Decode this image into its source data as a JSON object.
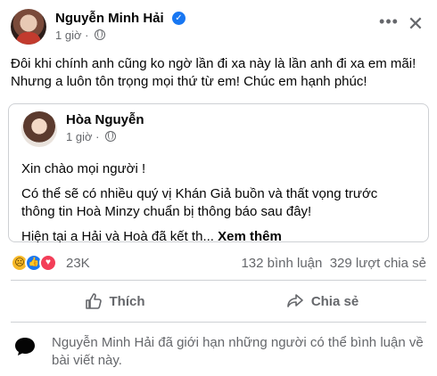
{
  "post": {
    "author": "Nguyễn Minh Hải",
    "time": "1 giờ ·",
    "body_lines": [
      "Đôi khi chính anh cũng ko ngờ lần đi xa này là lần anh đi xa em mãi!",
      "Nhưng a luôn tôn trọng mọi thứ từ em! Chúc em hạnh phúc!"
    ],
    "more_icon": "more-horizontal-icon",
    "close_icon": "close-icon"
  },
  "shared": {
    "author": "Hòa Nguyễn",
    "time": "1 giờ ·",
    "lines": [
      "Xin chào mọi người !",
      "Có thể sẽ có nhiều quý vị Khán Giả buồn và thất vọng trước thông tin Hoà Minzy chuẩn bị thông báo sau đây!"
    ],
    "teaser": "Hiện tại a Hải và Hoà đã kết th... ",
    "see_more": "Xem thêm"
  },
  "reactions": {
    "count": "23K",
    "comments": "132 bình luận",
    "shares": "329 lượt chia sẻ",
    "types": [
      "sad",
      "like",
      "love"
    ]
  },
  "actions": {
    "like_label": "Thích",
    "share_label": "Chia sẻ"
  },
  "notice": {
    "text": "Nguyễn Minh Hải đã giới hạn những người có thể bình luận về bài viết này."
  },
  "colors": {
    "primary_text": "#050505",
    "secondary_text": "#65676b",
    "verified_blue": "#1877f2",
    "divider": "#ced0d4"
  }
}
